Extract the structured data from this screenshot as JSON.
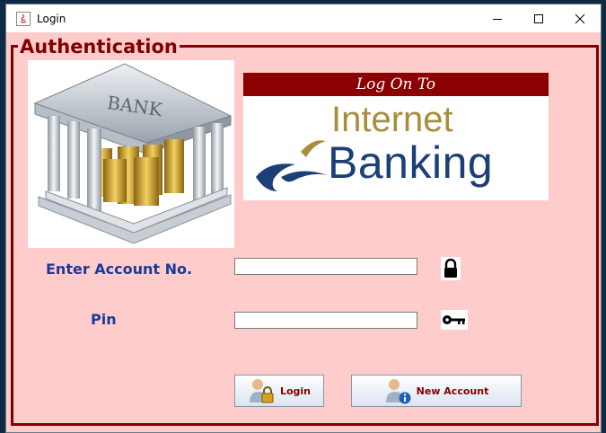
{
  "window": {
    "title": "Login"
  },
  "group": {
    "legend": "Authentication"
  },
  "banner": {
    "heading": "Log On To",
    "line1": "Internet",
    "line2": "Banking"
  },
  "bank_image": {
    "sign": "BANK"
  },
  "form": {
    "account_label": "Enter Account No.",
    "account_value": "",
    "pin_label": "Pin",
    "pin_value": ""
  },
  "buttons": {
    "login": "Login",
    "new_account": "New Account"
  },
  "icons": [
    "java-icon",
    "minimize-icon",
    "maximize-icon",
    "close-icon",
    "bank-building-icon",
    "lock-icon",
    "key-icon",
    "user-lock-icon",
    "user-info-icon"
  ],
  "colors": {
    "background": "#ffcccc",
    "border": "#800000",
    "label": "#1a3a9a",
    "banner_head": "#8b0000"
  }
}
